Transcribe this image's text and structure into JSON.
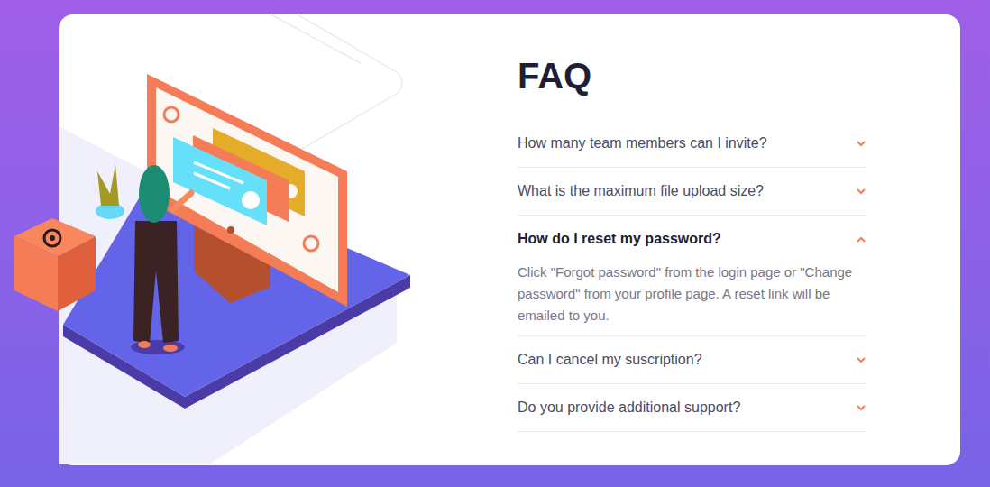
{
  "heading": "FAQ",
  "items": [
    {
      "question": "How many team members can I invite?",
      "expanded": false
    },
    {
      "question": "What is the maximum file upload size?",
      "expanded": false
    },
    {
      "question": "How do I reset my password?",
      "expanded": true,
      "answer": "Click \"Forgot password\" from the login page or \"Change password\" from your profile page. A reset link will be emailed to you."
    },
    {
      "question": "Can I cancel my suscription?",
      "expanded": false
    },
    {
      "question": "Do you provide additional support?",
      "expanded": false
    }
  ]
}
